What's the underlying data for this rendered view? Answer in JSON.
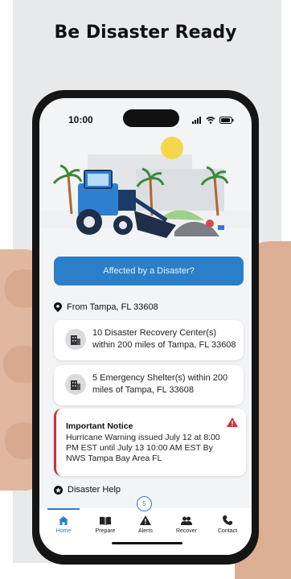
{
  "headline": "Be Disaster Ready",
  "status_bar": {
    "time": "10:00"
  },
  "cta": {
    "label": "Affected by a Disaster?"
  },
  "location": {
    "label": "From Tampa, FL 33608"
  },
  "cards": [
    {
      "text": "10 Disaster Recovery Center(s) within 200 miles of Tampa, FL 33608",
      "icon": "building-icon"
    },
    {
      "text": "5 Emergency Shelter(s) within 200 miles of Tampa, FL 33608",
      "icon": "building-icon"
    }
  ],
  "notice": {
    "title": "Important Notice",
    "body": "Hurricane Warning issued July 12 at 8:00 PM EST until July 13 10:00 AM EST By NWS Tampa Bay Area FL"
  },
  "disaster_help": {
    "label": "Disaster Help"
  },
  "tabs": {
    "home": "Home",
    "prepare": "Prepare",
    "alerts": "Alerts",
    "alerts_badge": "5",
    "recover": "Recover",
    "contact": "Contact"
  },
  "colors": {
    "accent": "#2b7fc8",
    "alert": "#c6343a"
  }
}
